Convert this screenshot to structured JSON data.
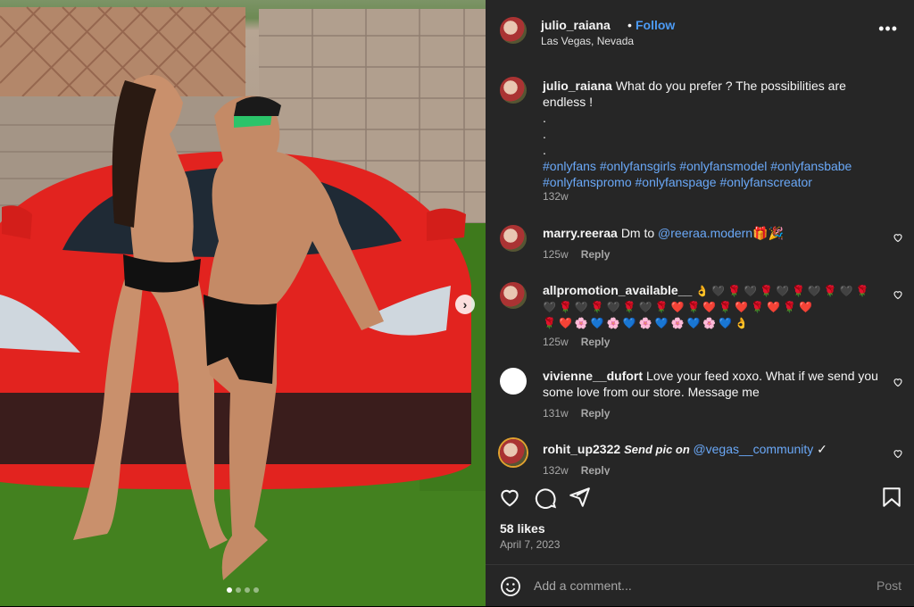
{
  "post": {
    "username": "julio_raiana",
    "separator": "•",
    "follow_label": "Follow",
    "location": "Las Vegas, Nevada",
    "more_icon": "more-horizontal-icon",
    "image_next_icon": "chevron-right-icon",
    "carousel_count": 4,
    "carousel_active": 1
  },
  "caption": {
    "username": "julio_raiana",
    "text": "What do you prefer ? The possibilities are endless !",
    "dots": [
      ".",
      ".",
      "."
    ],
    "hashtags_line1": "#onlyfans #onlyfansgirls #onlyfansmodel #onlyfansbabe",
    "hashtags_line2": "#onlyfanspromo #onlyfanspage #onlyfanscreator",
    "time": "132w"
  },
  "comments": [
    {
      "username": "marry.reeraa",
      "text": "Dm to ",
      "mention": "@reeraa.modern",
      "suffix": "🎁🎉",
      "time": "125w",
      "reply": "Reply"
    },
    {
      "username": "allpromotion_available__",
      "text": "👌🖤🌹🖤🌹🖤🌹🖤🌹🖤🌹",
      "line2": "🖤🌹🖤🌹🖤🌹🖤🌹❤️🌹❤️🌹❤️🌹❤️🌹❤️",
      "line3": "🌹❤️🌸💙🌸💙🌸💙🌸💙🌸💙👌",
      "time": "125w",
      "reply": "Reply"
    },
    {
      "username": "vivienne__dufort",
      "text": "Love your feed xoxo. What if we send you some love from our store. Message me",
      "time": "131w",
      "reply": "Reply"
    },
    {
      "username": "rohit_up2322",
      "text_bold": "Send pic on ",
      "mention": "@vegas__community",
      "suffix": " ✓",
      "time": "132w",
      "reply": "Reply"
    }
  ],
  "actions": {
    "like_icon": "heart-icon",
    "comment_icon": "comment-icon",
    "share_icon": "send-icon",
    "save_icon": "bookmark-icon"
  },
  "likes": "58 likes",
  "date": "April 7, 2023",
  "add_comment": {
    "emoji_icon": "smiley-icon",
    "placeholder": "Add a comment...",
    "post_label": "Post"
  }
}
